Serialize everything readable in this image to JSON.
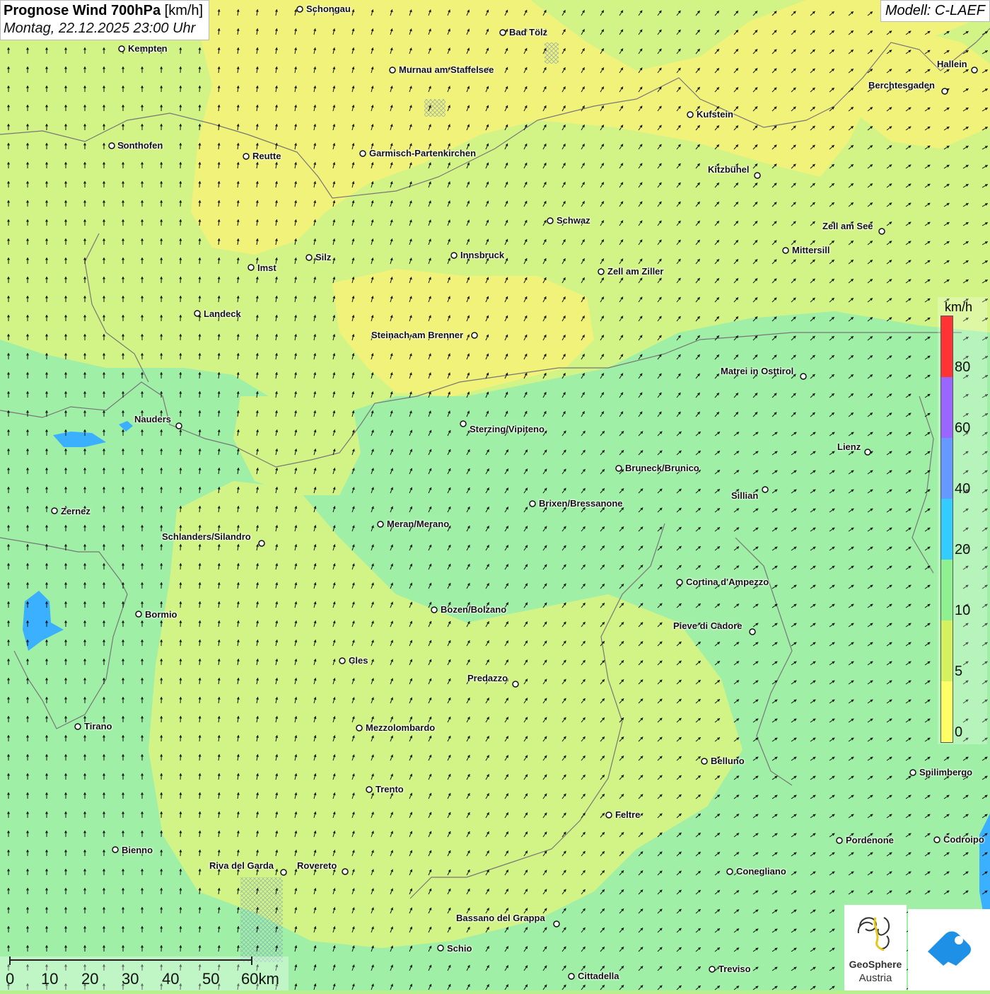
{
  "title": {
    "bold": "Prognose Wind 700hPa",
    "unit": "[km/h]",
    "date": "Montag, 22.12.2025 23:00 Uhr"
  },
  "model": "Modell: C-LAEF",
  "legend": {
    "unit": "km/h",
    "labels": [
      "80",
      "60",
      "40",
      "20",
      "10",
      "5",
      "0"
    ],
    "colors": {
      "c0_5": "#ffff66",
      "c5_10": "#d4f260",
      "c10_20": "#8ff08f",
      "c20_40": "#33ccff",
      "c40_60": "#6699ff",
      "c60_80": "#9966ff",
      "c80": "#ff3333"
    }
  },
  "map_colors": {
    "field_green": "#b6f08f",
    "field_lightgreen": "#d2f486",
    "field_yellow": "#f1f27a",
    "field_mint": "#9ff0a6",
    "lake": "#3ab0ff"
  },
  "cities": {
    "schongau": "Schongau",
    "kempten": "Kempten",
    "bad_toelz": "Bad Tölz",
    "murnau": "Murnau am Staffelsee",
    "hallein": "Hallein",
    "berchtesgaden": "Berchtesgaden",
    "kufstein": "Kufstein",
    "sonthofen": "Sonthofen",
    "reutte": "Reutte",
    "garmisch": "Garmisch-Partenkirchen",
    "kitzbuehel": "Kitzbühel",
    "schwaz": "Schwaz",
    "zell_am_see": "Zell am See",
    "mittersill": "Mittersill",
    "silz": "Silz",
    "innsbruck": "Innsbruck",
    "imst": "Imst",
    "zell_am_ziller": "Zell am Ziller",
    "landeck": "Landeck",
    "steinach": "Steinach am Brenner",
    "matrei": "Matrei in Osttirol",
    "nauders": "Nauders",
    "sterzing": "Sterzing/Vipiteno",
    "lienz": "Lienz",
    "bruneck": "Bruneck/Brunico",
    "sillian": "Sillian",
    "zernez": "Zernez",
    "brixen": "Brixen/Bressanone",
    "meran": "Meran/Merano",
    "schlanders": "Schlanders/Silandro",
    "cortina": "Cortina d'Ampezzo",
    "bormio": "Bormio",
    "bozen": "Bozen/Bolzano",
    "pieve": "Pieve di Cadore",
    "cles": "Cles",
    "predazzo": "Predazzo",
    "tirano": "Tirano",
    "mezzolombardo": "Mezzolombardo",
    "belluno": "Belluno",
    "spilimbergo": "Spilimbergo",
    "trento": "Trento",
    "feltre": "Feltre",
    "bienno": "Bienno",
    "pordenone": "Pordenone",
    "codroipo": "Codroipo",
    "riva": "Riva del Garda",
    "rovereto": "Rovereto",
    "conegliano": "Conegliano",
    "bassano": "Bassano del Grappa",
    "schio": "Schio",
    "treviso": "Treviso",
    "cittadella": "Cittadella"
  },
  "scale": {
    "labels": [
      "0",
      "10",
      "20",
      "30",
      "40",
      "50",
      "60km"
    ]
  },
  "logos": {
    "geosphere_line1": "GeoSphere",
    "geosphere_line2": "Austria"
  }
}
